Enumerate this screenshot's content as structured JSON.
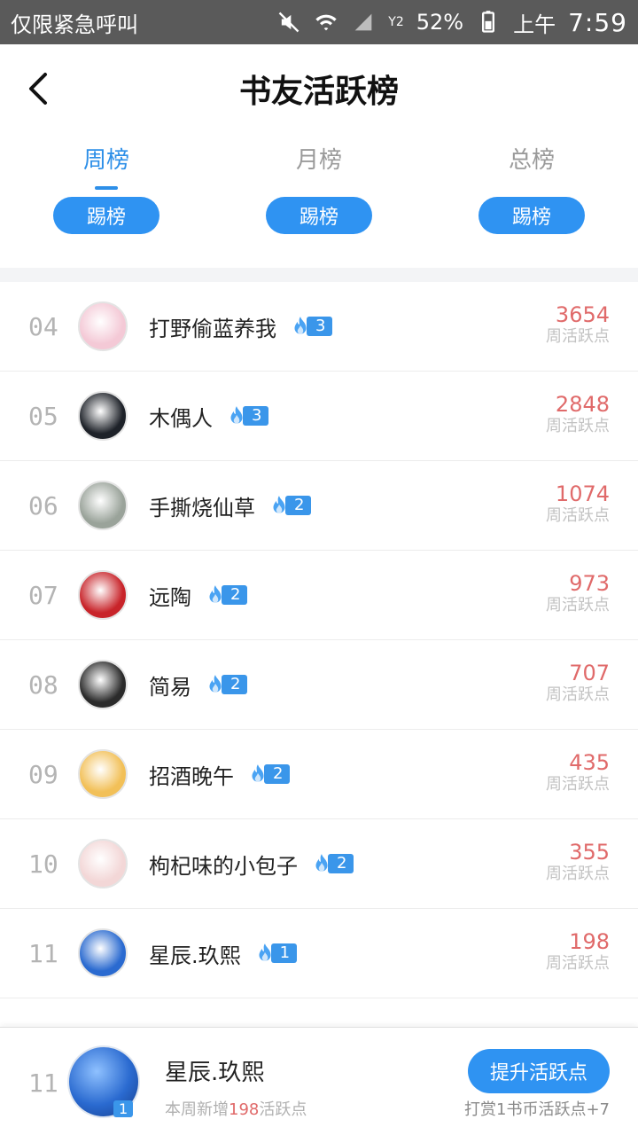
{
  "status_bar": {
    "carrier": "仅限紧急呼叫",
    "battery": "52%",
    "ampm": "上午",
    "time": "7:59",
    "signal_label": "Y2"
  },
  "header": {
    "title": "书友活跃榜"
  },
  "tabs": [
    {
      "label": "周榜",
      "active": true
    },
    {
      "label": "月榜",
      "active": false
    },
    {
      "label": "总榜",
      "active": false
    }
  ],
  "kick_label": "踢榜",
  "score_caption": "周活跃点",
  "rows": [
    {
      "rank": "04",
      "name": "打野偷蓝养我",
      "level": "3",
      "score": "3654",
      "avatar_color": "#f4c9d6"
    },
    {
      "rank": "05",
      "name": "木偶人",
      "level": "3",
      "score": "2848",
      "avatar_color": "#1e2229"
    },
    {
      "rank": "06",
      "name": "手撕烧仙草",
      "level": "2",
      "score": "1074",
      "avatar_color": "#9aa39a"
    },
    {
      "rank": "07",
      "name": "远陶",
      "level": "2",
      "score": "973",
      "avatar_color": "#c8242a"
    },
    {
      "rank": "08",
      "name": "简易",
      "level": "2",
      "score": "707",
      "avatar_color": "#2b2b2b"
    },
    {
      "rank": "09",
      "name": "招酒晚午",
      "level": "2",
      "score": "435",
      "avatar_color": "#f2c058"
    },
    {
      "rank": "10",
      "name": "枸杞味的小包子",
      "level": "2",
      "score": "355",
      "avatar_color": "#f3d7d7"
    },
    {
      "rank": "11",
      "name": "星辰.玖熙",
      "level": "1",
      "score": "198",
      "avatar_color": "#2a6ad0"
    }
  ],
  "footer": {
    "rank": "11",
    "name": "星辰.玖熙",
    "level": "1",
    "sub_prefix": "本周新增",
    "sub_value": "198",
    "sub_suffix": "活跃点",
    "promote_label": "提升活跃点",
    "tip": "打赏1书币活跃点+7"
  },
  "colors": {
    "accent": "#2f93f2",
    "score_red": "#e06a6a"
  }
}
